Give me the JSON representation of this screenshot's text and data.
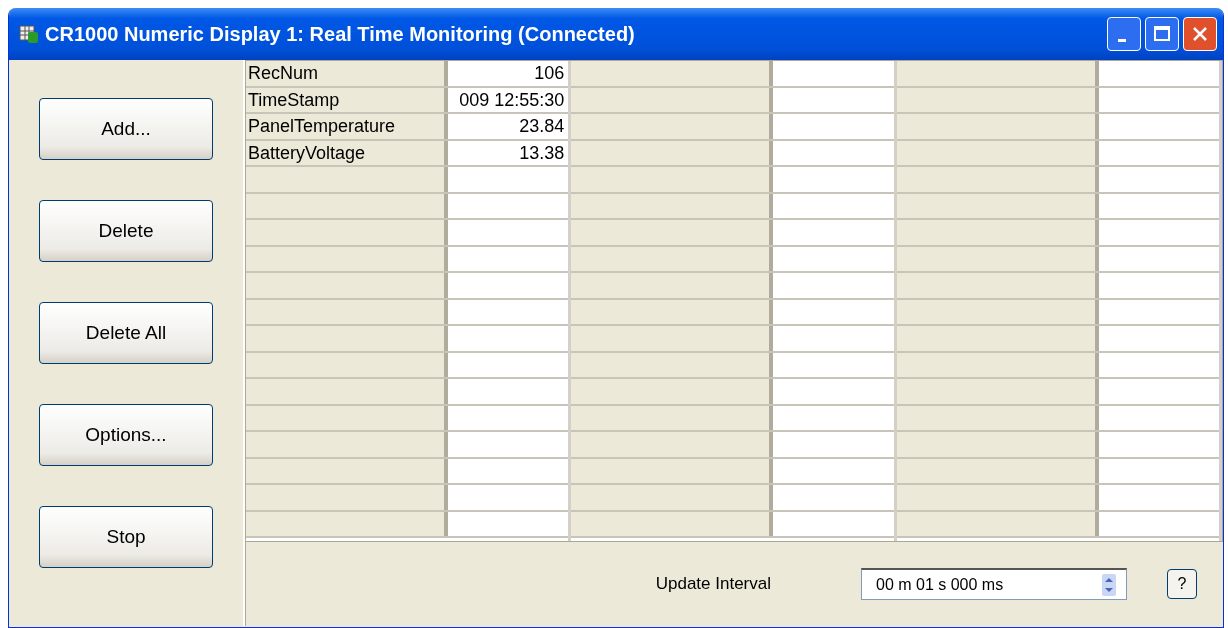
{
  "window": {
    "title": "CR1000 Numeric Display 1: Real Time Monitoring (Connected)"
  },
  "buttons": [
    "Add...",
    "Delete",
    "Delete All",
    "Options...",
    "Stop"
  ],
  "grid": {
    "columns": [
      {
        "rows": [
          {
            "name": "RecNum",
            "value": "106"
          },
          {
            "name": "TimeStamp",
            "value": "009 12:55:30"
          },
          {
            "name": "PanelTemperature",
            "value": "23.84"
          },
          {
            "name": "BatteryVoltage",
            "value": "13.38"
          }
        ]
      },
      {},
      {}
    ]
  },
  "update_interval": {
    "label": "Update Interval",
    "value": "00 m 01 s 000 ms"
  },
  "help_button": "?"
}
